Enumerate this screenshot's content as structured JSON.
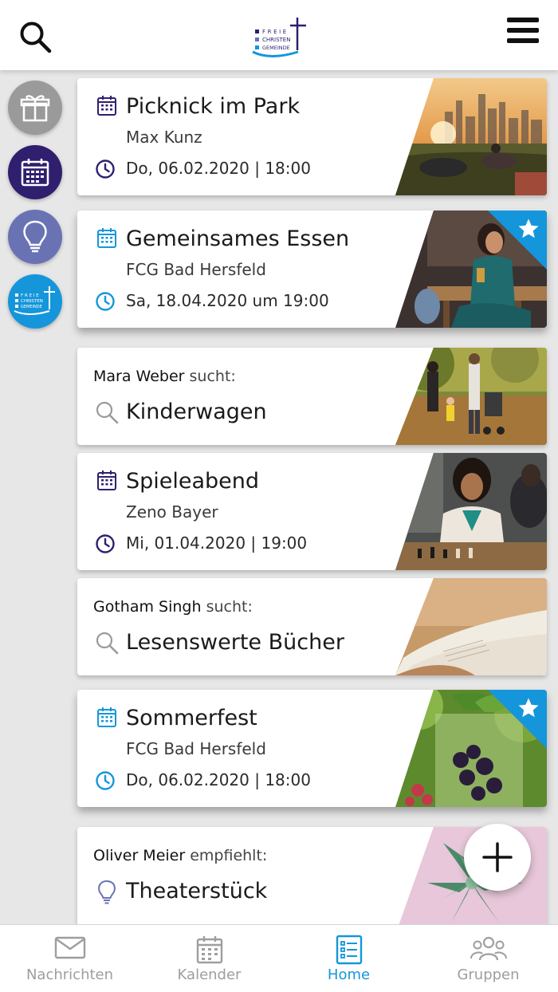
{
  "header": {
    "logo": {
      "line1": "FREIE",
      "line2": "CHRISTEN",
      "line3": "GEMEINDE"
    }
  },
  "rail": {
    "fcg_logo": {
      "line1": "FREIE",
      "line2": "CHRISTEN",
      "line3": "GEMEINDE"
    }
  },
  "feed": {
    "cards": [
      {
        "type": "event",
        "title": "Picknick im Park",
        "organizer": "Max Kunz",
        "time": "Do, 06.02.2020 | 18:00",
        "favorite": false,
        "icon_color": "#2f1f6e",
        "photo_icon": "picnic-photo"
      },
      {
        "type": "event",
        "title": "Gemeinsames Essen",
        "organizer": "FCG Bad Hersfeld",
        "time": "Sa, 18.04.2020 um 19:00",
        "favorite": true,
        "icon_color": "#1596db",
        "photo_icon": "dinner-photo"
      },
      {
        "type": "request",
        "person": "Mara Weber",
        "verb": "sucht:",
        "title": "Kinderwagen",
        "photo_icon": "family-walk-photo"
      },
      {
        "type": "event",
        "title": "Spieleabend",
        "organizer": "Zeno Bayer",
        "time": "Mi, 01.04.2020 | 19:00",
        "favorite": false,
        "icon_color": "#2f1f6e",
        "photo_icon": "chess-photo"
      },
      {
        "type": "request",
        "person": "Gotham Singh",
        "verb": "sucht:",
        "title": "Lesenswerte Bücher",
        "photo_icon": "book-photo"
      },
      {
        "type": "event",
        "title": "Sommerfest",
        "organizer": "FCG Bad Hersfeld",
        "time": "Do, 06.02.2020 | 18:00",
        "favorite": true,
        "icon_color": "#1596db",
        "photo_icon": "berry-drink-photo"
      },
      {
        "type": "recommendation",
        "person": "Oliver Meier",
        "verb": "empfiehlt:",
        "title": "Theaterstück",
        "photo_icon": "succulent-photo"
      }
    ]
  },
  "bottom_nav": {
    "items": [
      {
        "label": "Nachrichten",
        "icon": "envelope-icon",
        "active": false
      },
      {
        "label": "Kalender",
        "icon": "calendar-icon",
        "active": false
      },
      {
        "label": "Home",
        "icon": "list-icon",
        "active": true
      },
      {
        "label": "Gruppen",
        "icon": "group-icon",
        "active": false
      }
    ]
  },
  "colors": {
    "primary_dark": "#2f1f6e",
    "accent_blue": "#1596db",
    "idea_purple": "#6973b4",
    "background": "#e7e7e7"
  }
}
